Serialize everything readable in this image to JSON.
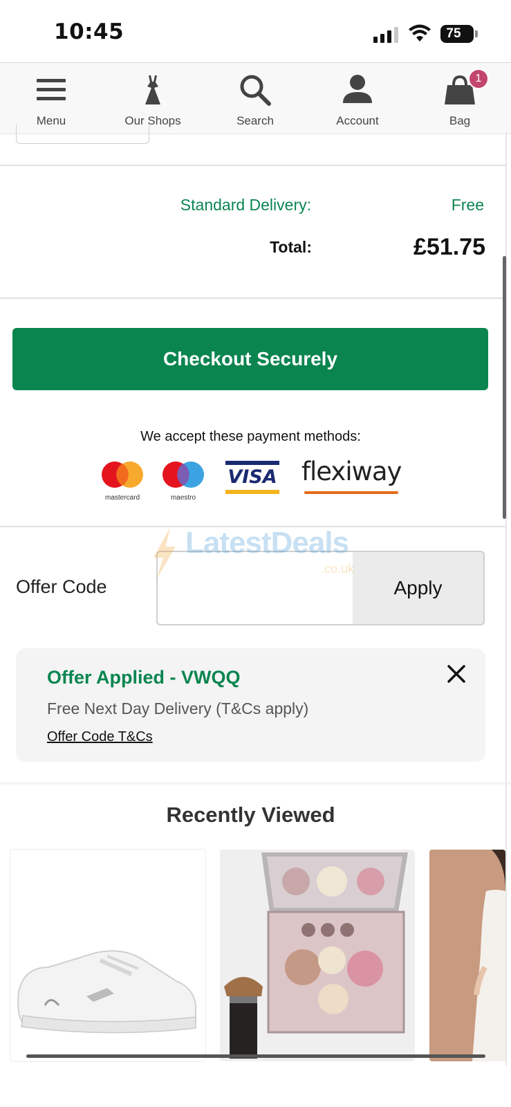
{
  "status_bar": {
    "time": "10:45",
    "battery": "75"
  },
  "nav": {
    "items": [
      {
        "label": "Menu",
        "icon": "hamburger-icon"
      },
      {
        "label": "Our Shops",
        "icon": "dress-icon"
      },
      {
        "label": "Search",
        "icon": "search-icon"
      },
      {
        "label": "Account",
        "icon": "user-icon"
      },
      {
        "label": "Bag",
        "icon": "bag-icon"
      }
    ],
    "bag_count": "1"
  },
  "summary": {
    "delivery_label": "Standard Delivery:",
    "delivery_value": "Free",
    "total_label": "Total:",
    "total_value": "£51.75"
  },
  "checkout": {
    "button_label": "Checkout Securely"
  },
  "payment": {
    "caption": "We accept these payment methods:",
    "methods": [
      "mastercard",
      "maestro",
      "VISA",
      "flexiway"
    ]
  },
  "offer": {
    "label": "Offer Code",
    "input_value": "",
    "apply_label": "Apply",
    "applied_title": "Offer Applied - VWQQ",
    "applied_desc": "Free Next Day Delivery (T&Cs apply)",
    "tcs_link": "Offer Code T&Cs"
  },
  "watermark": {
    "text": "LatestDeals",
    "sub": ".co.uk"
  },
  "recently_viewed": {
    "title": "Recently Viewed",
    "items": [
      {
        "icon": "sneaker-image"
      },
      {
        "icon": "makeup-palette-image"
      },
      {
        "icon": "model-dress-image"
      }
    ]
  },
  "colors": {
    "brand_green": "#0b8550",
    "badge_pink": "#c2466d"
  }
}
